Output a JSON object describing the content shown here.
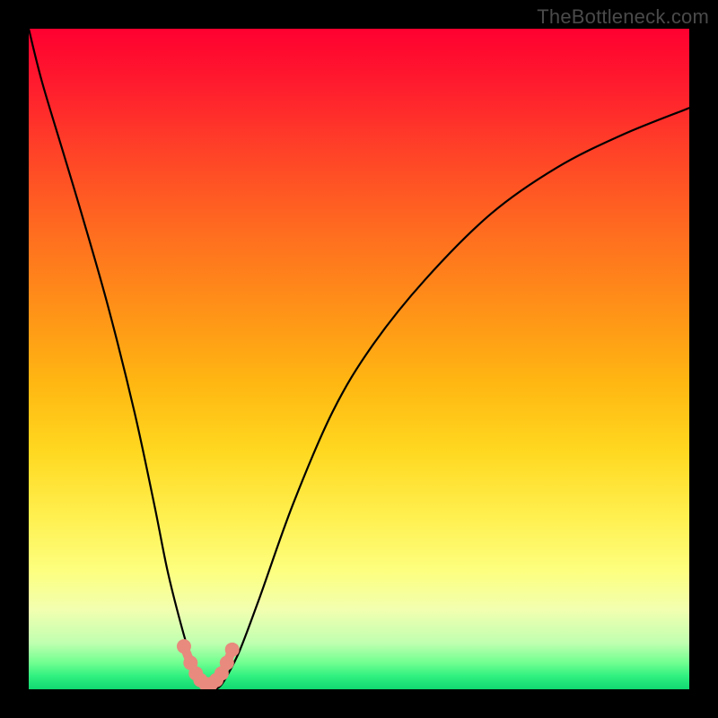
{
  "watermark": "TheBottleneck.com",
  "chart_data": {
    "type": "line",
    "title": "",
    "xlabel": "",
    "ylabel": "",
    "xlim": [
      0,
      100
    ],
    "ylim": [
      0,
      100
    ],
    "grid": false,
    "series": [
      {
        "name": "bottleneck-curve",
        "x": [
          0,
          2,
          5,
          8,
          12,
          16,
          19,
          21,
          23,
          24.5,
          26,
          27,
          28,
          29,
          30,
          32,
          35,
          40,
          46,
          52,
          60,
          70,
          80,
          90,
          100
        ],
        "y": [
          100,
          92,
          82,
          72,
          58,
          42,
          28,
          18,
          10,
          5,
          2,
          0.5,
          0,
          0.5,
          2,
          6,
          14,
          28,
          42,
          52,
          62,
          72,
          79,
          84,
          88
        ]
      }
    ],
    "markers": {
      "name": "dip-markers",
      "color": "#e88a7d",
      "x": [
        23.5,
        24.5,
        25.3,
        26.0,
        26.8,
        27.6,
        28.4,
        29.2,
        30.0,
        30.8
      ],
      "y": [
        6.5,
        4.0,
        2.4,
        1.4,
        0.8,
        0.8,
        1.4,
        2.4,
        4.0,
        6.0
      ]
    },
    "background_gradient": {
      "top": "#ff0030",
      "mid": "#ffd820",
      "bottom": "#10d870"
    }
  }
}
